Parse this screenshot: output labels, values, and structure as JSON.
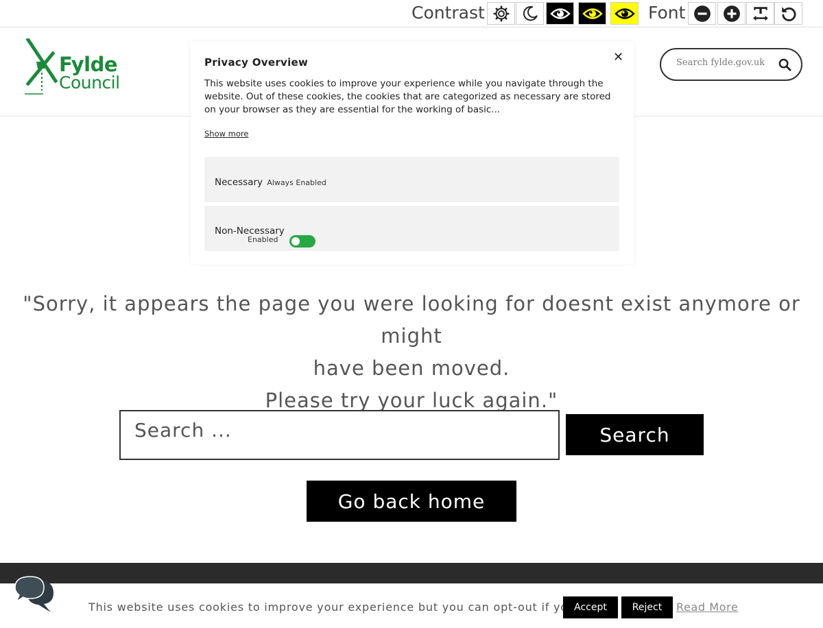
{
  "a11y": {
    "contrast_label": "Contrast",
    "font_label": "Font",
    "contrast_buttons": [
      {
        "name": "light-mode",
        "icon": "gear-icon"
      },
      {
        "name": "dark-mode",
        "icon": "moon-icon"
      },
      {
        "name": "high-contrast-white",
        "icon": "eye-icon"
      },
      {
        "name": "high-contrast-yellow-on-black",
        "icon": "eye-icon"
      },
      {
        "name": "high-contrast-black-on-yellow",
        "icon": "eye-icon"
      }
    ],
    "font_buttons": [
      {
        "name": "decrease-font",
        "icon": "minus-circle-icon"
      },
      {
        "name": "increase-font",
        "icon": "plus-circle-icon"
      },
      {
        "name": "readable-font",
        "icon": "text-width-icon"
      },
      {
        "name": "reset",
        "icon": "undo-icon"
      }
    ]
  },
  "header": {
    "logo_line1": "Fylde",
    "logo_line2": "Council",
    "search_placeholder": "Search fylde.gov.uk",
    "brand_color": "#1a8a3a"
  },
  "privacy": {
    "title": "Privacy Overview",
    "close": "✕",
    "body": "This website uses cookies to improve your experience while you navigate through the website. Out of these cookies, the cookies that are categorized as necessary are stored on your browser as they are essential for the working of basic...",
    "show_more": "Show more",
    "necessary_label": "Necessary",
    "necessary_note": "Always Enabled",
    "non_necessary_label": "Non-Necessary",
    "non_necessary_state": "Enabled",
    "toggle_color": "#28a745"
  },
  "error": {
    "line1": "\"Sorry, it appears the page you were looking for doesnt exist anymore or might",
    "line2": "have been moved.",
    "line3": "Please try your luck again.\"",
    "search_placeholder": "Search ...",
    "search_button": "Search",
    "home_button": "Go back home"
  },
  "cookie_bar": {
    "text": "This website uses cookies to improve your experience but you can opt-out if you wish.",
    "accept": "Accept",
    "reject": "Reject",
    "read_more": "Read More"
  }
}
